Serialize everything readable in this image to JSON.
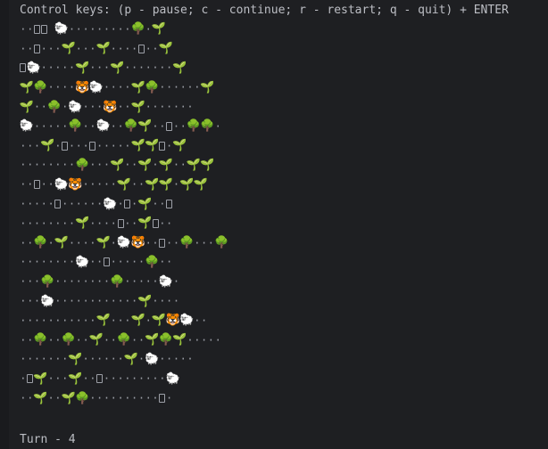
{
  "header": {
    "control_keys": "Control keys: (p - pause; c - continue; r - restart; q - quit) + ENTER"
  },
  "legend": {
    "empty": "·",
    "unknown": "▯",
    "sheep": "🐑",
    "tree": "🌳",
    "sprout": "🌱",
    "tiger": "🐯"
  },
  "grid": {
    "rows": [
      "..?? S.........T.P",
      "..?...P...P....?..P",
      "?S.....P...P.......P",
      "PT....XS....PT......P",
      "P..T.S...X..P.......",
      "S.....T..S..TP..?..TT.",
      "...P.?...?.....PP?.P",
      "........T...P..P.P..PP",
      "..?..SX.....P..PP.PP",
      ".....?......S.?.P..?",
      "........P....?..P?..",
      "..T.P....P.SX..?..T...T",
      "........S..?.....T..",
      "...T........T.....S.",
      "...S............P....",
      "...........P...P.PXS..",
      "..T..T..P..T..PTP.....",
      ".......P......P.S.....",
      ".?P...P..?.........S",
      "..P..PT..........?."
    ]
  },
  "footer": {
    "turn_label": "Turn - ",
    "turn_value": "4"
  }
}
